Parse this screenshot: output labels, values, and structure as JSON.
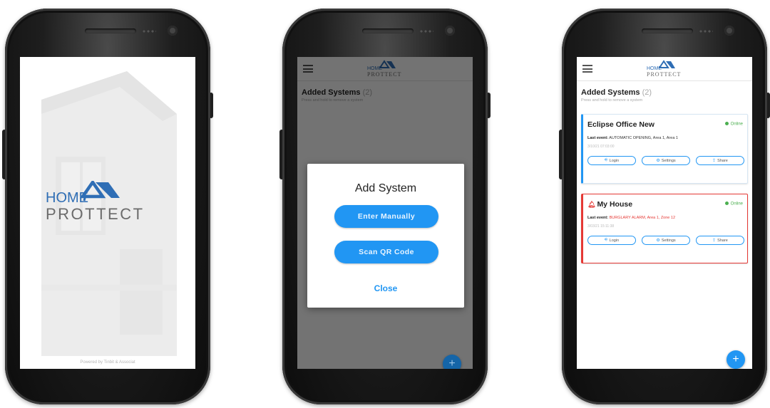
{
  "brand": {
    "word_home": "HOME",
    "word_prottect": "PROTTECT",
    "primary_color": "#2196f3",
    "logo_blue": "#2f6eb5",
    "logo_gray": "#6b6b6b"
  },
  "splash": {
    "powered_by": "Powered by Tinbit & Associat"
  },
  "app_header": {
    "menu_icon": "hamburger-menu-icon"
  },
  "systems_header": {
    "title": "Added Systems",
    "count": "(2)",
    "hint": "Press and hold to remove a system"
  },
  "add_system_dialog": {
    "title": "Add System",
    "enter_manually": "Enter Manually",
    "scan_qr": "Scan QR Code",
    "close": "Close"
  },
  "fab": {
    "icon": "plus-icon",
    "label": "+"
  },
  "systems": [
    {
      "name": "Eclipse Office New",
      "status": "Online",
      "last_event_label": "Last event:",
      "last_event": "AUTOMATIC OPENING, Area 1, Area 1",
      "time": "3/10/21 07:03:00",
      "alarm": false,
      "actions": [
        "Login",
        "Settings",
        "Share"
      ]
    },
    {
      "name": "My House",
      "status": "Online",
      "last_event_label": "Last event:",
      "last_event": "BURGLARY ALARM, Area 1, Zone 12",
      "time": "3/03/21 15:11:38",
      "alarm": true,
      "actions": [
        "Login",
        "Settings",
        "Share"
      ]
    }
  ],
  "status_colors": {
    "online": "#4caf50",
    "alarm": "#e53935"
  }
}
